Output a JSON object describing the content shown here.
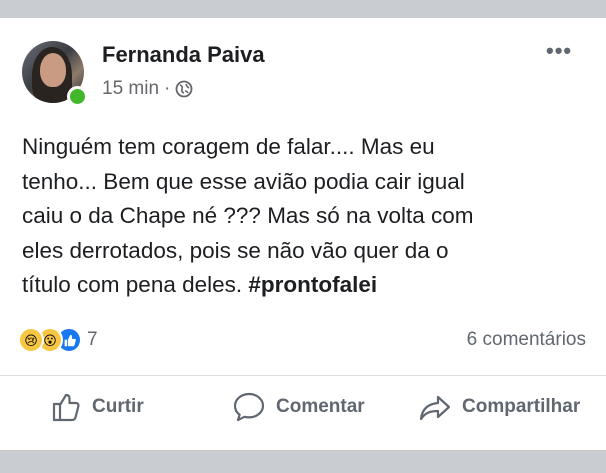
{
  "post": {
    "author": "Fernanda Paiva",
    "timestamp": "15 min",
    "separator": "·",
    "text_lines": [
      "Ninguém tem coragem de falar.... Mas eu",
      "tenho... Bem que esse avião podia cair igual",
      "caiu o da Chape né ??? Mas só na volta com",
      "eles derrotados, pois se não vão quer da o",
      "título com pena deles. "
    ],
    "hashtag": "#prontofalei",
    "reactions": {
      "icons": [
        "sad-reaction-icon",
        "wow-reaction-icon",
        "like-reaction-icon"
      ],
      "count": "7"
    },
    "comments": "6 comentários"
  },
  "actions": {
    "like": "Curtir",
    "comment": "Comentar",
    "share": "Compartilhar"
  },
  "colors": {
    "text": "#1c1e21",
    "muted": "#65676b",
    "online": "#42b72a",
    "like_blue": "#1877f2",
    "emoji_yellow": "#f7c744"
  }
}
